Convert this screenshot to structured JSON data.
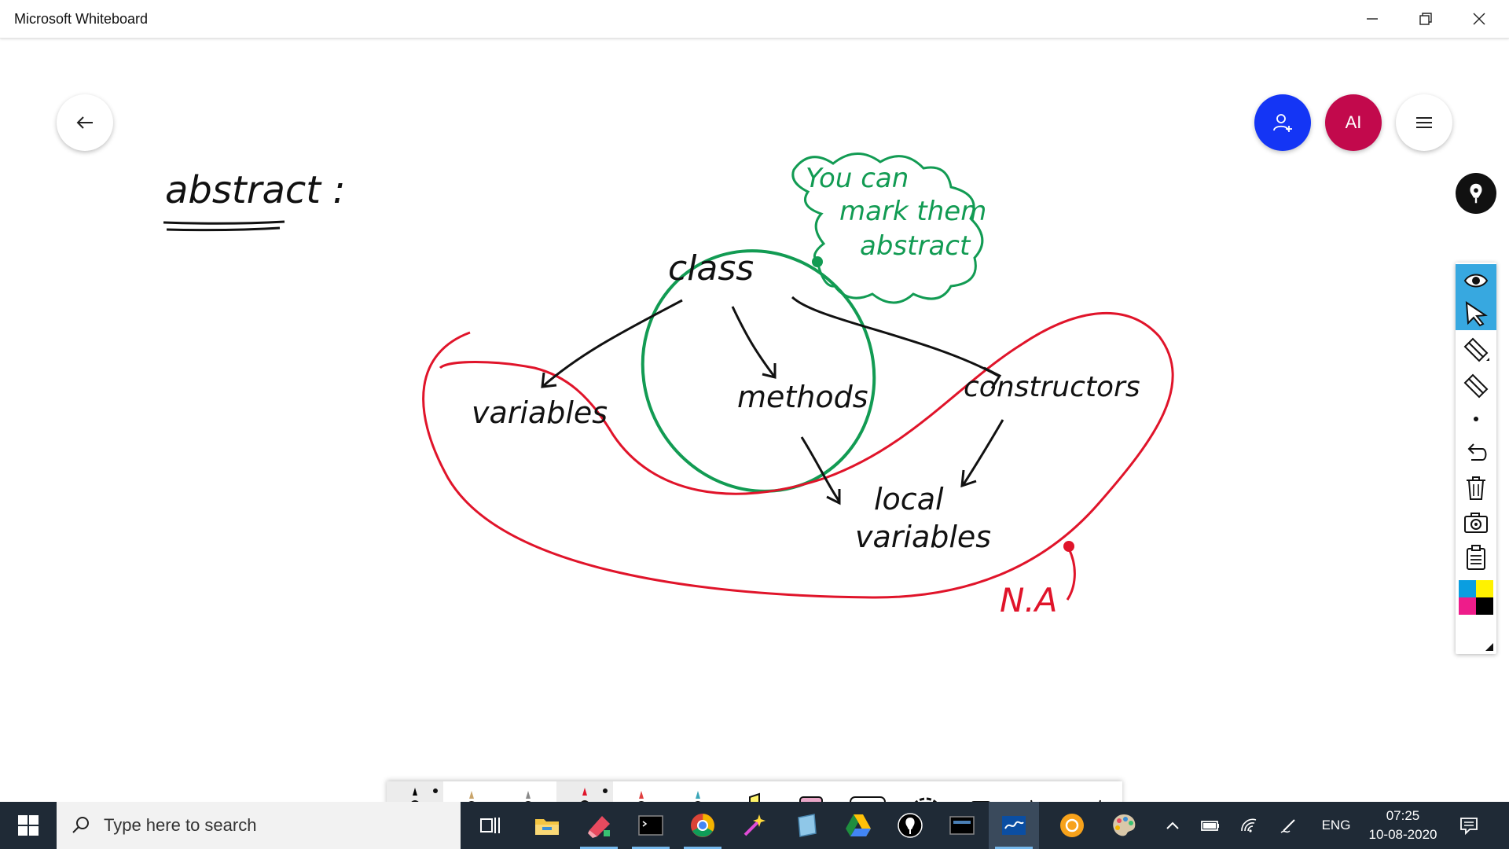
{
  "window": {
    "title": "Microsoft Whiteboard",
    "controls": [
      "minimize",
      "restore",
      "close"
    ]
  },
  "canvas_controls": {
    "back_icon": "arrow-left-icon",
    "invite_icon": "person-add-icon",
    "avatar_initials": "AI",
    "menu_icon": "hamburger-menu-icon",
    "colors": {
      "invite": "#1435f5",
      "avatar": "#c2094c"
    }
  },
  "ink": {
    "heading": "abstract :",
    "center_node": "class",
    "nodes": [
      "variables",
      "methods",
      "constructors"
    ],
    "leaf": [
      "local",
      "variables"
    ],
    "callout": [
      "You can",
      "mark them",
      "abstract"
    ],
    "na_label": "N.A",
    "colors": {
      "black": "#111111",
      "green": "#129b53",
      "red": "#e0142a"
    }
  },
  "right_toolbar": {
    "items": [
      "ink-to-shape-icon",
      "eye-icon",
      "select-cursor-icon",
      "ruler-eraser-icon",
      "eraser-icon",
      "dot-icon",
      "undo-icon",
      "delete-icon",
      "camera-icon",
      "clipboard-icon",
      "color-palette-icon"
    ],
    "active_item": "eye-icon"
  },
  "bottom_toolbar": {
    "tools": [
      {
        "name": "black-pen",
        "color": "#000000",
        "selected": true
      },
      {
        "name": "gold-pen",
        "color": "#c9a46a",
        "selected": false
      },
      {
        "name": "silver-pen",
        "color": "#aaaaaa",
        "selected": false
      },
      {
        "name": "red-pen",
        "color": "#e0142a",
        "selected": true
      },
      {
        "name": "rainbow-pen",
        "color": "#e04040",
        "selected": false
      },
      {
        "name": "galaxy-pen",
        "color": "#3aa6b8",
        "selected": false
      },
      {
        "name": "highlighter",
        "color": "#fff46a",
        "selected": false
      },
      {
        "name": "eraser",
        "color": "#e9a7c8",
        "selected": false
      },
      {
        "name": "ruler",
        "color": "#333333",
        "selected": false
      },
      {
        "name": "lasso",
        "color": "#333333",
        "selected": false
      },
      {
        "name": "add",
        "color": "#333333",
        "selected": false
      },
      {
        "name": "undo",
        "color": "#333333",
        "selected": false
      },
      {
        "name": "redo",
        "color": "#333333",
        "selected": false
      }
    ]
  },
  "taskbar": {
    "search_placeholder": "Type here to search",
    "apps": [
      "task-view-icon",
      "file-explorer-icon",
      "paint-3d-icon",
      "terminal-icon",
      "chrome-icon",
      "magic-wand-icon",
      "notebook-icon",
      "google-drive-icon",
      "whiteboard-pin-icon",
      "mysql-icon",
      "whiteboard-icon",
      "circle-app-icon",
      "paint-palette-icon"
    ],
    "active_app": "whiteboard-icon",
    "language": "ENG",
    "time": "07:25",
    "date": "10-08-2020"
  }
}
